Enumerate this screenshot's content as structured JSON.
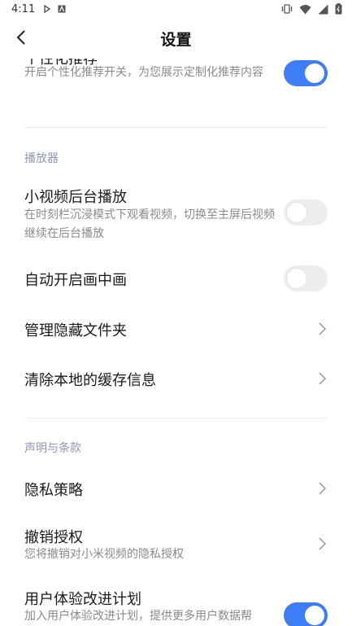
{
  "status_bar": {
    "time": "4:11",
    "left_icons": [
      "play-protect-icon",
      "a-notification-icon"
    ],
    "right_icons": [
      "vibrate-icon",
      "wifi-icon",
      "signal-icon",
      "battery-icon"
    ]
  },
  "header": {
    "title": "设置",
    "back_icon": "back-arrow-icon"
  },
  "colors": {
    "accent": "#3d7df5",
    "toggle_off": "#ededed",
    "section_header": "#8e96b0",
    "description": "#8a8a8a"
  },
  "settings": {
    "personalized": {
      "title": "个性化推荐",
      "desc": "开启个性化推荐开关，为您展示定制化推荐内容",
      "enabled": true
    },
    "player_section": "播放器",
    "background_play": {
      "title": "小视频后台播放",
      "desc": "在时刻栏沉浸模式下观看视频，切换至主屏后视频继续在后台播放",
      "enabled": false
    },
    "pip": {
      "title": "自动开启画中画",
      "enabled": false
    },
    "hidden_folder": {
      "title": "管理隐藏文件夹"
    },
    "clear_cache": {
      "title": "清除本地的缓存信息"
    },
    "terms_section": "声明与条款",
    "privacy": {
      "title": "隐私策略"
    },
    "revoke": {
      "title": "撤销授权",
      "desc": "您将撤销对小米视频的隐私授权"
    },
    "ux_plan": {
      "title": "用户体验改进计划",
      "desc": "加入用户体验改进计划，提供更多用户数据帮",
      "enabled": true
    }
  }
}
